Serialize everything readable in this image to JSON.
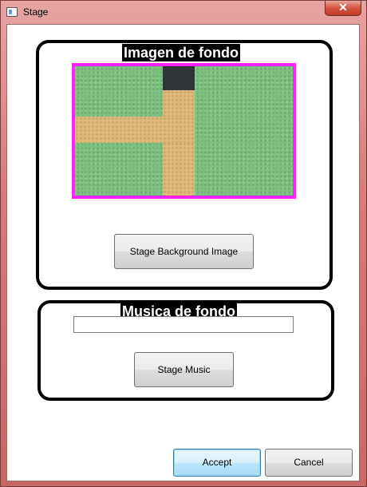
{
  "window": {
    "title": "Stage",
    "close_symbol": "✕"
  },
  "background_section": {
    "title": "Imagen de fondo",
    "button_label": "Stage Background Image"
  },
  "music_section": {
    "title": "Musica de fondo",
    "music_path": "",
    "button_label": "Stage Music"
  },
  "footer": {
    "accept_label": "Accept",
    "cancel_label": "Cancel"
  },
  "colors": {
    "preview_border": "#ff22ff",
    "grass": "#7cc17f",
    "path": "#dcbb7c",
    "dark_tile": "#2f3436"
  }
}
